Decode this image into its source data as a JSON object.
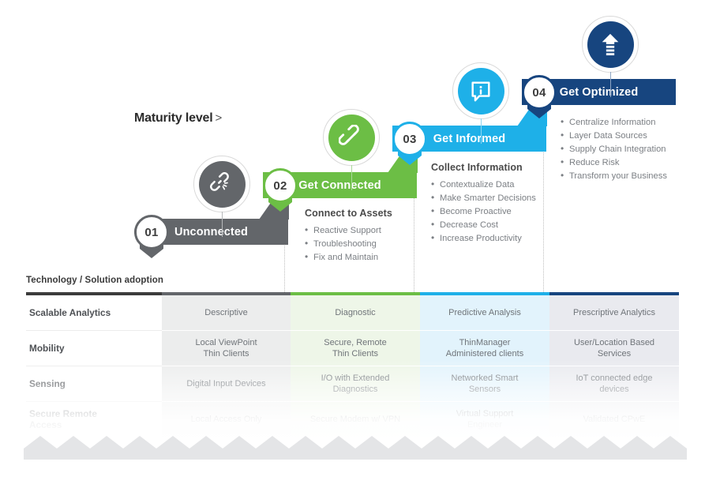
{
  "header": {
    "maturity_label": "Maturity level",
    "maturity_chevron": ">"
  },
  "stages": [
    {
      "number": "01",
      "title": "Unconnected",
      "color": "#63666a",
      "icon": "broken-chain-link-icon",
      "detail_heading": "",
      "details": []
    },
    {
      "number": "02",
      "title": "Get Connected",
      "color": "#6cbe45",
      "icon": "chain-link-icon",
      "detail_heading": "Connect to Assets",
      "details": [
        "Reactive Support",
        "Troubleshooting",
        "Fix and Maintain"
      ]
    },
    {
      "number": "03",
      "title": "Get Informed",
      "color": "#1eb0e8",
      "icon": "info-bubble-icon",
      "detail_heading": "Collect Information",
      "details": [
        "Contextualize Data",
        "Make Smarter Decisions",
        "Become Proactive",
        "Decrease Cost",
        "Increase Productivity"
      ]
    },
    {
      "number": "04",
      "title": "Get Optimized",
      "color": "#17457f",
      "icon": "upward-arrow-icon",
      "detail_heading": "",
      "details": [
        "Centralize Information",
        "Layer Data Sources",
        "Supply Chain Integration",
        "Reduce Risk",
        "Transform your Business"
      ]
    }
  ],
  "table": {
    "caption": "Technology / Solution adoption",
    "column_accent_colors": [
      "#3c3c3c",
      "#63666a",
      "#6cbe45",
      "#1eb0e8",
      "#17457f"
    ],
    "rows": [
      {
        "label": "Scalable Analytics",
        "cells": [
          "Descriptive",
          "Diagnostic",
          "Predictive Analysis",
          "Prescriptive Analytics"
        ]
      },
      {
        "label": "Mobility",
        "cells": [
          "Local ViewPoint\nThin Clients",
          "Secure, Remote\nThin Clients",
          "ThinManager\nAdministered clients",
          "User/Location Based\nServices"
        ]
      },
      {
        "label": "Sensing",
        "cells": [
          "Digital Input Devices",
          "I/O with Extended\nDiagnostics",
          "Networked Smart\nSensors",
          "IoT connected edge\ndevices"
        ]
      },
      {
        "label": "Secure Remote\nAccess",
        "cells": [
          "Local Access Only",
          "Secure Modem w/ VPN",
          "Virtual Support\nEngineer",
          "Validated CPwE"
        ]
      }
    ]
  }
}
